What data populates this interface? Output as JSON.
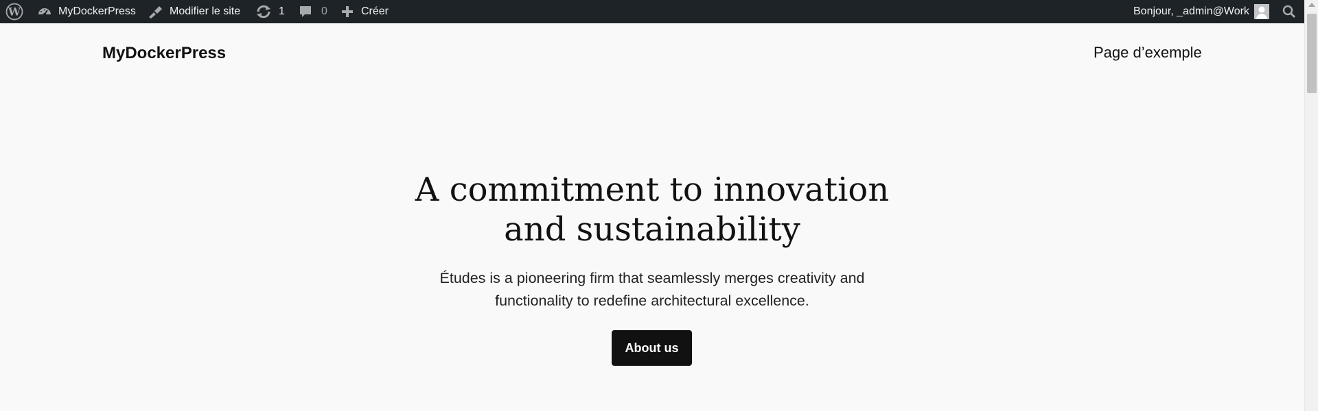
{
  "adminbar": {
    "wp_logo_icon": "wordpress-logo-icon",
    "site_name": "MyDockerPress",
    "site_icon": "dashboard-icon",
    "edit_site_label": "Modifier le site",
    "edit_site_icon": "brush-icon",
    "updates_count": "1",
    "updates_icon": "update-icon",
    "comments_count": "0",
    "comments_icon": "comment-icon",
    "new_label": "Créer",
    "new_icon": "plus-icon",
    "greeting": "Bonjour, _admin@Work",
    "avatar_icon": "avatar-icon",
    "search_icon": "search-icon",
    "background_color": "#1d2327"
  },
  "site": {
    "title": "MyDockerPress",
    "nav_link": "Page d’exemple"
  },
  "hero": {
    "title_line1": "A commitment to innovation",
    "title_line2": "and sustainability",
    "text_line1": "Études is a pioneering firm that seamlessly merges creativity and",
    "text_line2": "functionality to redefine architectural excellence.",
    "button_label": "About us",
    "button_color": "#111111"
  }
}
